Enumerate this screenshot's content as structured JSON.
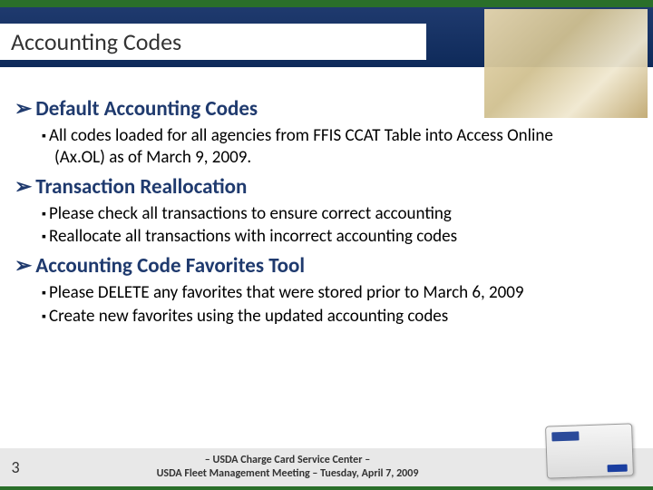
{
  "title": "Accounting Codes",
  "sections": [
    {
      "heading": "Default Accounting Codes",
      "bullets": [
        "All codes loaded for all agencies from FFIS CCAT Table into Access Online (Ax.OL) as of March 9, 2009."
      ]
    },
    {
      "heading": " Transaction Reallocation",
      "bullets": [
        "Please check all transactions to ensure correct accounting",
        "Reallocate all transactions with incorrect accounting codes"
      ]
    },
    {
      "heading": "Accounting Code Favorites Tool",
      "bullets": [
        "Please DELETE any favorites that were stored prior to March 6, 2009",
        "Create new favorites using the updated accounting codes"
      ]
    }
  ],
  "footer": {
    "page": "3",
    "line1": "– USDA Charge Card Service Center –",
    "line2": "USDA Fleet Management Meeting – Tuesday, April 7, 2009"
  }
}
